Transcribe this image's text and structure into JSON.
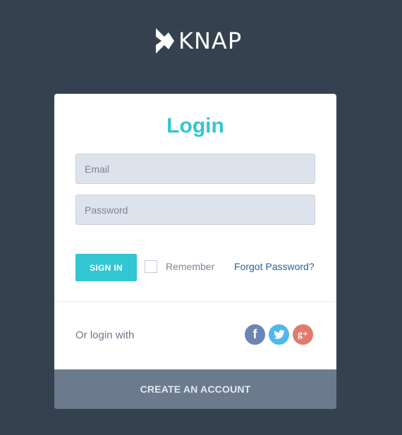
{
  "logo": {
    "text": "KNAP"
  },
  "login": {
    "title": "Login",
    "email_placeholder": "Email",
    "password_placeholder": "Password",
    "signin_label": "SIGN IN",
    "remember_label": "Remember",
    "forgot_label": "Forgot Password?",
    "or_login_with": "Or login with",
    "create_account_label": "CREATE AN ACCOUNT"
  },
  "social": [
    {
      "icon": "facebook-icon",
      "glyph": "f",
      "color": "#6d84b4"
    },
    {
      "icon": "twitter-icon",
      "glyph": "",
      "color": "#4fb8ed"
    },
    {
      "icon": "google-plus-icon",
      "glyph": "g+",
      "color": "#e17a6c"
    }
  ],
  "colors": {
    "background": "#364150",
    "accent": "#32c5d2",
    "link": "#2a6496",
    "footer": "#6c7a8d"
  }
}
